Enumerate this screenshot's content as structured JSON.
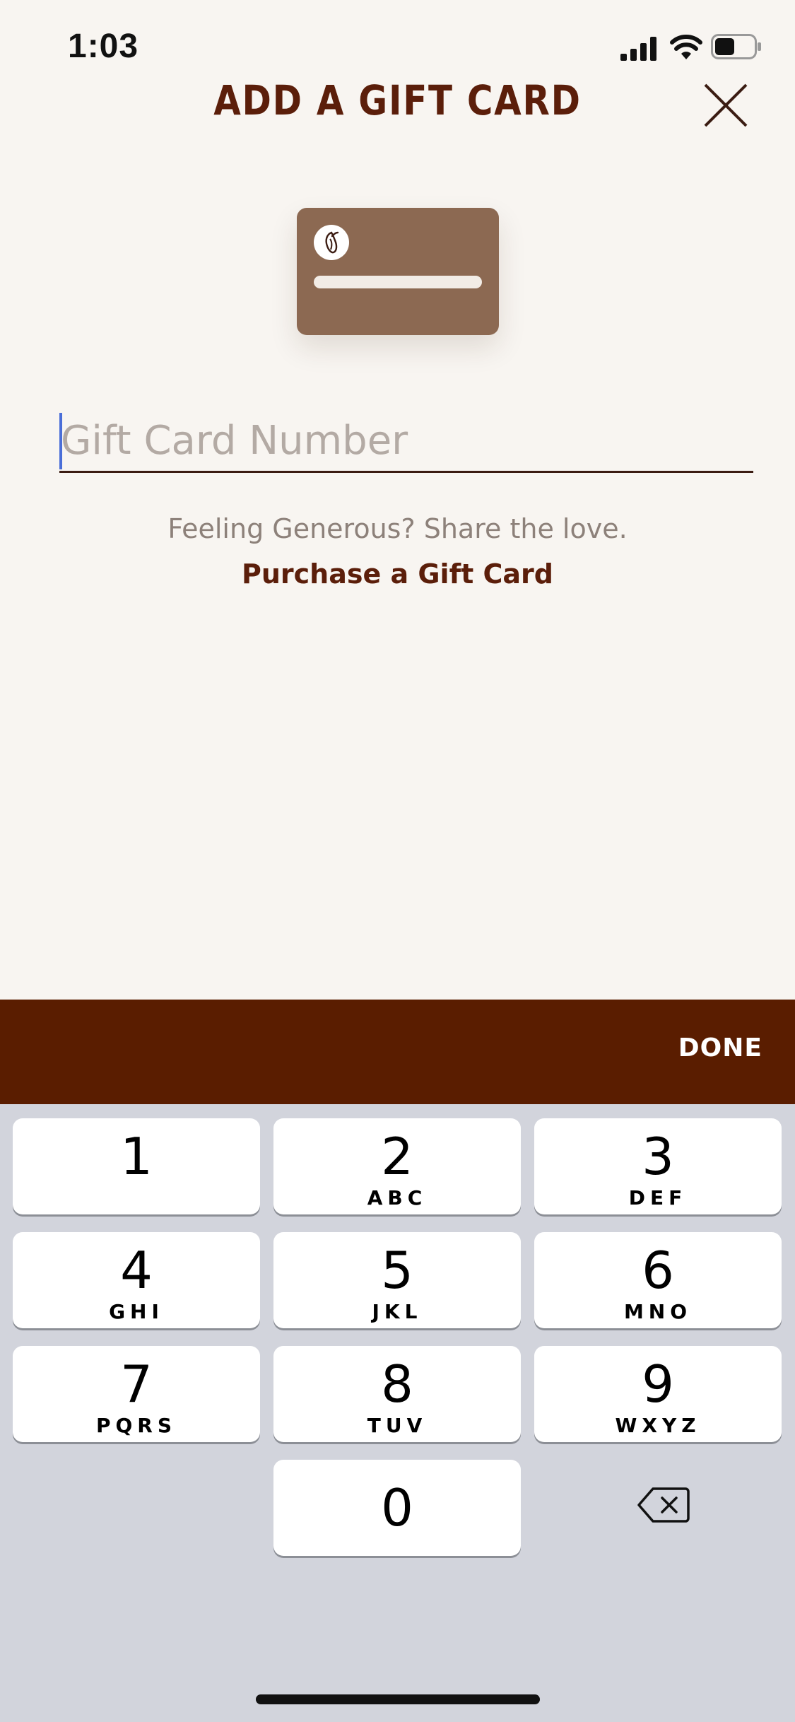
{
  "status_bar": {
    "time": "1:03",
    "battery_level": 0.5
  },
  "header": {
    "title": "ADD A GIFT CARD"
  },
  "form": {
    "gift_card_placeholder": "Gift Card Number",
    "gift_card_value": ""
  },
  "tagline": "Feeling Generous? Share the love.",
  "purchase_link": "Purchase a Gift Card",
  "accessory_bar": {
    "done_label": "DONE"
  },
  "keypad": {
    "keys": [
      {
        "digit": "1",
        "letters": ""
      },
      {
        "digit": "2",
        "letters": "ABC"
      },
      {
        "digit": "3",
        "letters": "DEF"
      },
      {
        "digit": "4",
        "letters": "GHI"
      },
      {
        "digit": "5",
        "letters": "JKL"
      },
      {
        "digit": "6",
        "letters": "MNO"
      },
      {
        "digit": "7",
        "letters": "PQRS"
      },
      {
        "digit": "8",
        "letters": "TUV"
      },
      {
        "digit": "9",
        "letters": "WXYZ"
      },
      {
        "digit": "0",
        "letters": ""
      }
    ]
  },
  "colors": {
    "brand_brown": "#5b1e0a",
    "accessory_bar": "#5a1d00",
    "card_brown": "#8c6952",
    "background": "#f8f5f1",
    "keypad_background": "#d2d4dc",
    "cursor": "#4a6ed8"
  }
}
